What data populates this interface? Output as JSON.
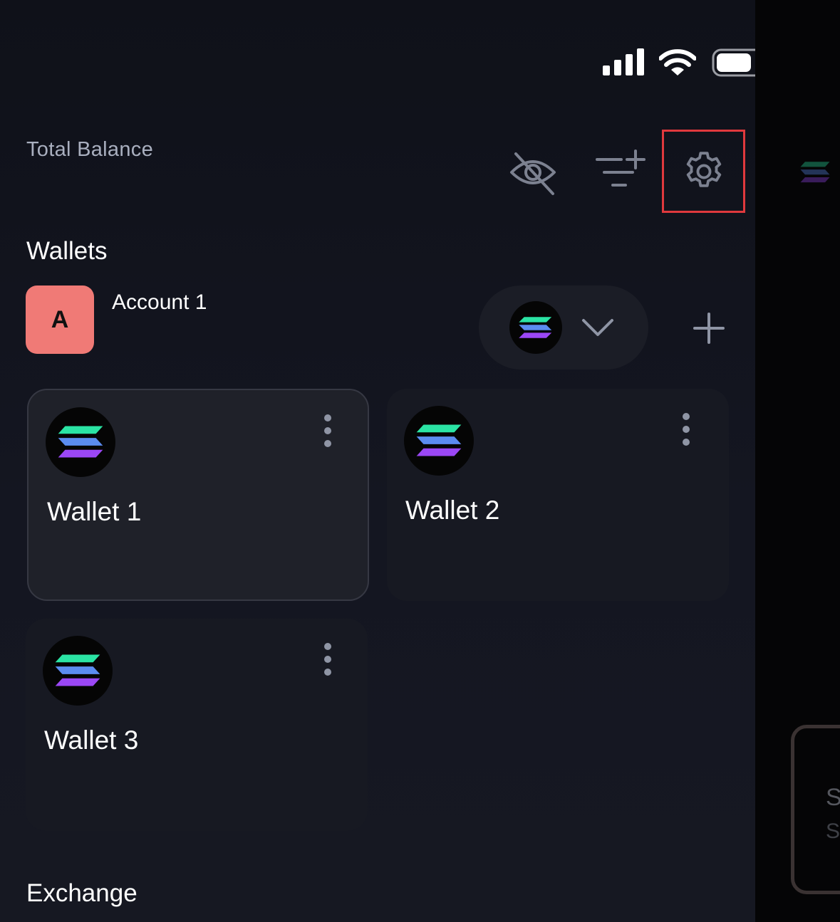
{
  "header": {
    "total_balance_label": "Total Balance",
    "icons": [
      "eye-off-icon",
      "filter-add-icon",
      "gear-icon"
    ]
  },
  "status_bar": {
    "icons": [
      "signal-icon",
      "wifi-icon",
      "battery-icon"
    ]
  },
  "wallets_section": {
    "title": "Wallets",
    "account": {
      "avatar_letter": "A",
      "avatar_color": "#f07a76",
      "name": "Account 1"
    },
    "chain_selector_icon": "solana-logo-icon",
    "items": [
      {
        "name": "Wallet 1",
        "selected": true
      },
      {
        "name": "Wallet 2",
        "selected": false
      },
      {
        "name": "Wallet 3",
        "selected": false
      }
    ]
  },
  "exchange_section": {
    "title": "Exchange"
  },
  "peek": {
    "card_line1": "S",
    "card_line2": "S"
  },
  "colors": {
    "background": "#12141c",
    "card": "#171922",
    "card_selected": "#1f2129",
    "highlight_border": "#e0393d",
    "solana_green": "#14f195",
    "solana_purple": "#9945ff"
  }
}
